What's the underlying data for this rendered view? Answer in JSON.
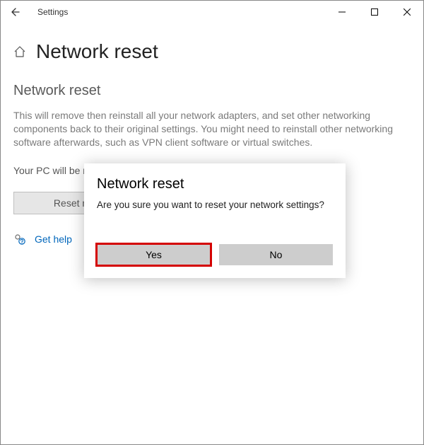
{
  "titlebar": {
    "app_title": "Settings"
  },
  "page": {
    "title": "Network reset",
    "section_title": "Network reset",
    "description": "This will remove then reinstall all your network adapters, and set other networking components back to their original settings. You might need to reinstall other networking software afterwards, such as VPN client software or virtual switches.",
    "restart_msg": "Your PC will be restarted.",
    "reset_button": "Reset now",
    "help_link": "Get help"
  },
  "dialog": {
    "title": "Network reset",
    "message": "Are you sure you want to reset your network settings?",
    "yes": "Yes",
    "no": "No"
  }
}
